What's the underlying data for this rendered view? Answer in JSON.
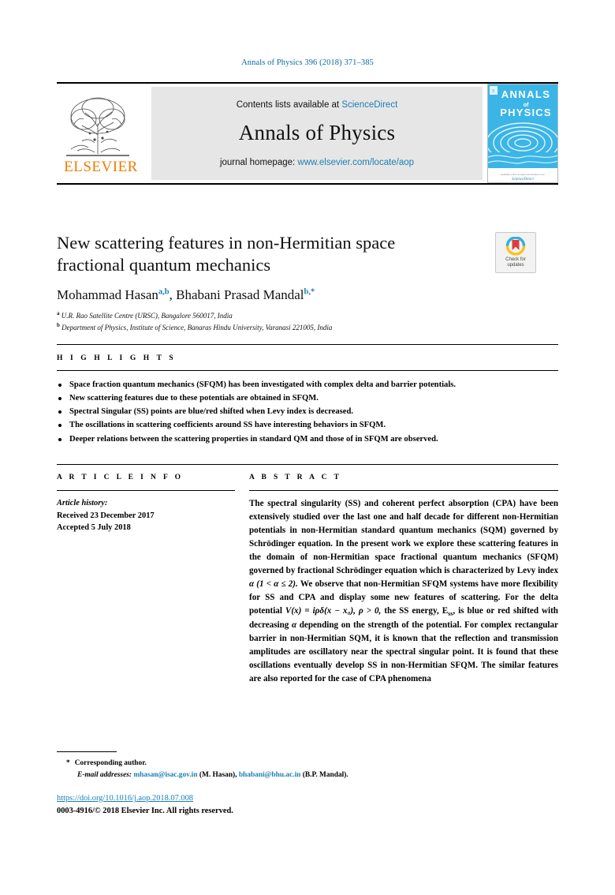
{
  "running_head": "Annals of Physics 396 (2018) 371–385",
  "masthead": {
    "publisher_name": "ELSEVIER",
    "contents_prefix": "Contents lists available at ",
    "contents_link": "ScienceDirect",
    "journal_title": "Annals of Physics",
    "homepage_prefix": "journal homepage: ",
    "homepage_url": "www.elsevier.com/locate/aop",
    "cover": {
      "line1": "ANNALS",
      "line2": "of",
      "line3": "PHYSICS",
      "footer_caption": "ScienceDirect"
    },
    "colors": {
      "link_blue": "#1a7fb5",
      "elsevier_orange": "#ef7d00",
      "cover_blue": "#29abe2",
      "box_gray": "#e6e6e6"
    }
  },
  "title": {
    "text": "New scattering features in non-Hermitian space fractional quantum mechanics"
  },
  "crossmark": {
    "label_line1": "Check for",
    "label_line2": "updates"
  },
  "authors": {
    "author1_name": "Mohammad Hasan",
    "author1_marks": "a,b",
    "separator": ", ",
    "author2_name": "Bhabani Prasad Mandal",
    "author2_marks": "b,*"
  },
  "affiliations": [
    {
      "mark": "a",
      "text": "U.R. Rao Satellite Centre (URSC), Bangalore 560017, India"
    },
    {
      "mark": "b",
      "text": "Department of Physics, Institute of Science, Banaras Hindu University, Varanasi 221005, India"
    }
  ],
  "highlights": {
    "heading": "H I G H L I G H T S",
    "items": [
      "Space fraction quantum mechanics (SFQM) has been investigated with complex delta and barrier potentials.",
      "New scattering features due to these potentials are obtained in SFQM.",
      "Spectral Singular (SS) points are blue/red shifted when Levy index is decreased.",
      "The oscillations in scattering coefficients around SS have interesting behaviors in SFQM.",
      "Deeper relations between the scattering properties in standard QM and those of in SFQM are observed."
    ]
  },
  "article_info": {
    "heading": "A R T I C L E    I N F O",
    "history_label": "Article history:",
    "received": "Received 23 December 2017",
    "accepted": "Accepted 5 July 2018"
  },
  "abstract": {
    "heading": "A B S T R A C T",
    "part1": "The spectral singularity (SS) and coherent perfect absorption (CPA) have been extensively studied over the last one and half decade for different non-Hermitian potentials in non-Hermitian standard quantum mechanics (SQM) governed by Schrödinger equation. In the present work we explore these scattering features in the domain of non-Hermitian space fractional quantum mechanics (SFQM) governed by fractional Schrödinger equation which is characterized by Levy index ",
    "alpha1": "α",
    "range": " (1 < α ≤ 2). ",
    "part2": "We observe that non-Hermitian SFQM systems have more flexibility for SS and CPA and display some new features of scattering. For the delta potential ",
    "potential_formula": "V(x) = iρδ(x − x₀), ρ > 0,",
    "part3": " the SS energy, ",
    "energy_symbol": "E",
    "energy_subscript": "ss",
    "part4": ", is blue or red shifted with decreasing ",
    "alpha2": "α",
    "part5": " depending on the strength of the potential. For complex rectangular barrier in non-Hermitian SQM, it is known that the reflection and transmission amplitudes are oscillatory near the spectral singular point. It is found that these oscillations eventually develop SS in non-Hermitian SFQM. The similar features are also reported for the case of CPA phenomena"
  },
  "footnotes": {
    "corresponding_star": "*",
    "corresponding_text": "Corresponding author.",
    "email_label": "E-mail addresses:",
    "email1": "mhasan@isac.gov.in",
    "email1_owner": "(M. Hasan),",
    "email2": "bhabani@bhu.ac.in",
    "email2_owner": "(B.P. Mandal)."
  },
  "publication": {
    "doi": "https://doi.org/10.1016/j.aop.2018.07.008",
    "copyright": "0003-4916/© 2018 Elsevier Inc. All rights reserved."
  }
}
